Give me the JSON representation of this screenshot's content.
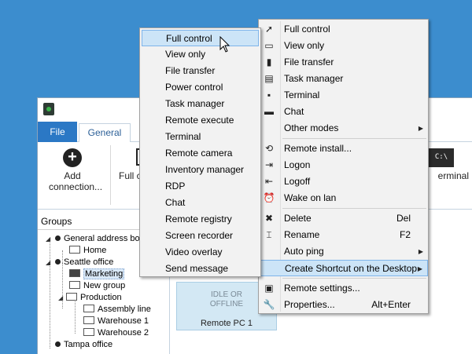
{
  "app": {
    "tabs": {
      "file": "File",
      "general": "General"
    },
    "ribbon": {
      "add_label": "Add connection...",
      "full_partial": "Full c",
      "terminal_icon_text": "C:\\",
      "terminal_partial": "erminal"
    },
    "groups": {
      "header": "Groups",
      "items": [
        "General address bo",
        "Home",
        "Seattle office",
        "Marketing",
        "New group",
        "Production",
        "Assembly line",
        "Warehouse 1",
        "Warehouse 2",
        "Tampa office"
      ]
    },
    "computer": {
      "status": "IDLE OR OFFLINE",
      "status_line1": "IDLE OR",
      "status_line2": "OFFLINE",
      "name": "Remote PC 1"
    }
  },
  "context_menu": {
    "items": [
      {
        "label": "Full control",
        "icon": "cursor-icon"
      },
      {
        "label": "View only",
        "icon": "monitor-icon"
      },
      {
        "label": "File transfer",
        "icon": "files-icon"
      },
      {
        "label": "Task manager",
        "icon": "task-manager-icon"
      },
      {
        "label": "Terminal",
        "icon": "terminal-icon"
      },
      {
        "label": "Chat",
        "icon": "chat-icon"
      },
      {
        "label": "Other modes",
        "icon": ""
      },
      {
        "label": "Remote install...",
        "icon": "refresh-icon"
      },
      {
        "label": "Logon",
        "icon": "logon-icon"
      },
      {
        "label": "Logoff",
        "icon": "logoff-icon"
      },
      {
        "label": "Wake on lan",
        "icon": "alarm-clock-icon"
      },
      {
        "label": "Delete",
        "icon": "delete-icon",
        "shortcut": "Del"
      },
      {
        "label": "Rename",
        "icon": "rename-icon",
        "shortcut": "F2"
      },
      {
        "label": "Auto ping",
        "icon": ""
      },
      {
        "label": "Create Shortcut on the Desktop",
        "icon": ""
      },
      {
        "label": "Remote settings...",
        "icon": "remote-settings-icon"
      },
      {
        "label": "Properties...",
        "icon": "wrench-icon",
        "shortcut": "Alt+Enter"
      }
    ]
  },
  "submenu": {
    "items": [
      "Full control",
      "View only",
      "File transfer",
      "Power control",
      "Task manager",
      "Remote execute",
      "Terminal",
      "Remote camera",
      "Inventory manager",
      "RDP",
      "Chat",
      "Remote registry",
      "Screen recorder",
      "Video overlay",
      "Send message"
    ]
  }
}
